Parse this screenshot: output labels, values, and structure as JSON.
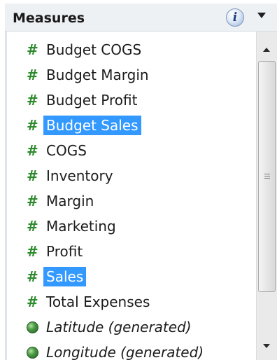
{
  "panel": {
    "title": "Measures",
    "info_glyph": "i",
    "info_icon": "info-icon",
    "menu_icon": "dropdown-arrow-icon"
  },
  "colors": {
    "selection": "#3399ff",
    "measure_icon": "#2d8a2d",
    "header_bg": "#eef1f4"
  },
  "fields": [
    {
      "label": "Budget COGS",
      "icon": "measure-hash-icon",
      "glyph": "#",
      "selected": false,
      "italic": false
    },
    {
      "label": "Budget Margin",
      "icon": "measure-hash-icon",
      "glyph": "#",
      "selected": false,
      "italic": false
    },
    {
      "label": "Budget Profit",
      "icon": "measure-hash-icon",
      "glyph": "#",
      "selected": false,
      "italic": false
    },
    {
      "label": "Budget Sales",
      "icon": "measure-hash-icon",
      "glyph": "#",
      "selected": true,
      "italic": false
    },
    {
      "label": "COGS",
      "icon": "measure-hash-icon",
      "glyph": "#",
      "selected": false,
      "italic": false
    },
    {
      "label": "Inventory",
      "icon": "measure-hash-icon",
      "glyph": "#",
      "selected": false,
      "italic": false
    },
    {
      "label": "Margin",
      "icon": "measure-hash-icon",
      "glyph": "#",
      "selected": false,
      "italic": false
    },
    {
      "label": "Marketing",
      "icon": "measure-hash-icon",
      "glyph": "#",
      "selected": false,
      "italic": false
    },
    {
      "label": "Profit",
      "icon": "measure-hash-icon",
      "glyph": "#",
      "selected": false,
      "italic": false
    },
    {
      "label": "Sales",
      "icon": "measure-hash-icon",
      "glyph": "#",
      "selected": true,
      "italic": false
    },
    {
      "label": "Total Expenses",
      "icon": "measure-hash-icon",
      "glyph": "#",
      "selected": false,
      "italic": false
    },
    {
      "label": "Latitude (generated)",
      "icon": "globe-icon",
      "glyph": "",
      "selected": false,
      "italic": true
    },
    {
      "label": "Longitude (generated)",
      "icon": "globe-icon",
      "glyph": "",
      "selected": false,
      "italic": true
    }
  ],
  "scrollbar": {
    "up_icon": "scroll-up-arrow-icon",
    "down_icon": "scroll-down-arrow-icon",
    "grip_icon": "scroll-grip-icon"
  }
}
